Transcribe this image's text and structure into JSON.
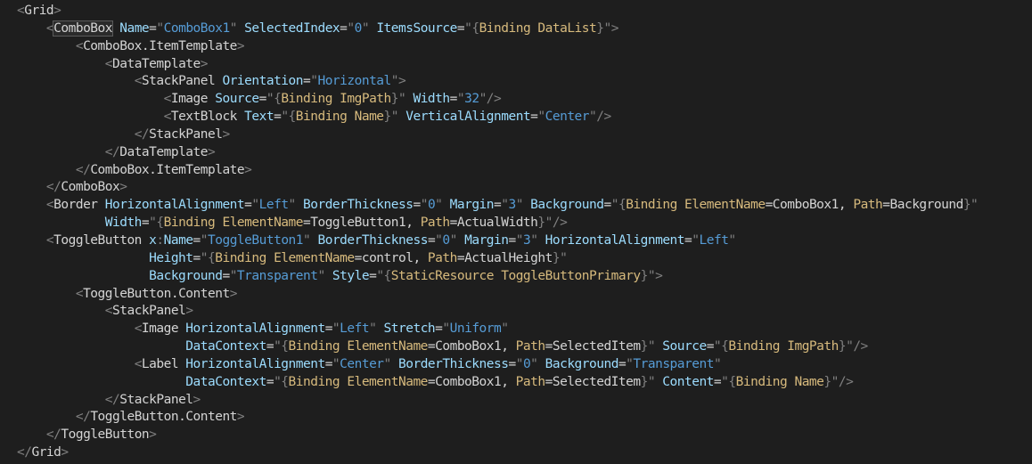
{
  "editor": {
    "background": "#1e1e1e",
    "token_colors": {
      "punctuation": "#808080",
      "tag": "#d4d4d4",
      "attribute": "#9cdcfe",
      "value": "#569cd6",
      "binding_keyword": "#d7ba7d",
      "binding_property": "#d7ba7d"
    },
    "lines": [
      {
        "indent": 0,
        "tokens": [
          [
            "p",
            "<"
          ],
          [
            "t",
            "Grid"
          ],
          [
            "p",
            ">"
          ]
        ]
      },
      {
        "indent": 4,
        "tokens": [
          [
            "p",
            "<"
          ],
          [
            "hl",
            "ComboBox"
          ],
          [
            "a",
            " Name"
          ],
          [
            "e",
            "="
          ],
          [
            "p",
            "\""
          ],
          [
            "v",
            "ComboBox1"
          ],
          [
            "p",
            "\""
          ],
          [
            "a",
            " SelectedIndex"
          ],
          [
            "e",
            "="
          ],
          [
            "p",
            "\""
          ],
          [
            "v",
            "0"
          ],
          [
            "p",
            "\""
          ],
          [
            "a",
            " ItemsSource"
          ],
          [
            "e",
            "="
          ],
          [
            "p",
            "\"{"
          ],
          [
            "bk",
            "Binding"
          ],
          [
            "bp",
            " DataList"
          ],
          [
            "p",
            "}\""
          ],
          [
            "p",
            ">"
          ]
        ]
      },
      {
        "indent": 8,
        "tokens": [
          [
            "p",
            "<"
          ],
          [
            "t",
            "ComboBox.ItemTemplate"
          ],
          [
            "p",
            ">"
          ]
        ]
      },
      {
        "indent": 12,
        "tokens": [
          [
            "p",
            "<"
          ],
          [
            "t",
            "DataTemplate"
          ],
          [
            "p",
            ">"
          ]
        ]
      },
      {
        "indent": 16,
        "tokens": [
          [
            "p",
            "<"
          ],
          [
            "t",
            "StackPanel"
          ],
          [
            "a",
            " Orientation"
          ],
          [
            "e",
            "="
          ],
          [
            "p",
            "\""
          ],
          [
            "v",
            "Horizontal"
          ],
          [
            "p",
            "\""
          ],
          [
            "p",
            ">"
          ]
        ]
      },
      {
        "indent": 20,
        "tokens": [
          [
            "p",
            "<"
          ],
          [
            "t",
            "Image"
          ],
          [
            "a",
            " Source"
          ],
          [
            "e",
            "="
          ],
          [
            "p",
            "\"{"
          ],
          [
            "bk",
            "Binding"
          ],
          [
            "bp",
            " ImgPath"
          ],
          [
            "p",
            "}\""
          ],
          [
            "a",
            " Width"
          ],
          [
            "e",
            "="
          ],
          [
            "p",
            "\""
          ],
          [
            "v",
            "32"
          ],
          [
            "p",
            "\""
          ],
          [
            "p",
            "/>"
          ]
        ]
      },
      {
        "indent": 20,
        "tokens": [
          [
            "p",
            "<"
          ],
          [
            "t",
            "TextBlock"
          ],
          [
            "a",
            " Text"
          ],
          [
            "e",
            "="
          ],
          [
            "p",
            "\"{"
          ],
          [
            "bk",
            "Binding"
          ],
          [
            "bp",
            " Name"
          ],
          [
            "p",
            "}\""
          ],
          [
            "a",
            " VerticalAlignment"
          ],
          [
            "e",
            "="
          ],
          [
            "p",
            "\""
          ],
          [
            "v",
            "Center"
          ],
          [
            "p",
            "\""
          ],
          [
            "p",
            "/>"
          ]
        ]
      },
      {
        "indent": 16,
        "tokens": [
          [
            "p",
            "</"
          ],
          [
            "t",
            "StackPanel"
          ],
          [
            "p",
            ">"
          ]
        ]
      },
      {
        "indent": 12,
        "tokens": [
          [
            "p",
            "</"
          ],
          [
            "t",
            "DataTemplate"
          ],
          [
            "p",
            ">"
          ]
        ]
      },
      {
        "indent": 8,
        "tokens": [
          [
            "p",
            "</"
          ],
          [
            "t",
            "ComboBox.ItemTemplate"
          ],
          [
            "p",
            ">"
          ]
        ]
      },
      {
        "indent": 4,
        "tokens": [
          [
            "p",
            "</"
          ],
          [
            "t",
            "ComboBox"
          ],
          [
            "p",
            ">"
          ]
        ]
      },
      {
        "indent": 4,
        "tokens": [
          [
            "p",
            "<"
          ],
          [
            "t",
            "Border"
          ],
          [
            "a",
            " HorizontalAlignment"
          ],
          [
            "e",
            "="
          ],
          [
            "p",
            "\""
          ],
          [
            "v",
            "Left"
          ],
          [
            "p",
            "\""
          ],
          [
            "a",
            " BorderThickness"
          ],
          [
            "e",
            "="
          ],
          [
            "p",
            "\""
          ],
          [
            "v",
            "0"
          ],
          [
            "p",
            "\""
          ],
          [
            "a",
            " Margin"
          ],
          [
            "e",
            "="
          ],
          [
            "p",
            "\""
          ],
          [
            "v",
            "3"
          ],
          [
            "p",
            "\""
          ],
          [
            "a",
            " Background"
          ],
          [
            "e",
            "="
          ],
          [
            "p",
            "\"{"
          ],
          [
            "bk",
            "Binding"
          ],
          [
            "bp",
            " ElementName"
          ],
          [
            "e",
            "="
          ],
          [
            "bw",
            "ComboBox1"
          ],
          [
            "e",
            ","
          ],
          [
            "bp",
            " Path"
          ],
          [
            "e",
            "="
          ],
          [
            "bw",
            "Background"
          ],
          [
            "p",
            "}\""
          ]
        ]
      },
      {
        "indent": 12,
        "tokens": [
          [
            "a",
            "Width"
          ],
          [
            "e",
            "="
          ],
          [
            "p",
            "\"{"
          ],
          [
            "bk",
            "Binding"
          ],
          [
            "bp",
            " ElementName"
          ],
          [
            "e",
            "="
          ],
          [
            "bw",
            "ToggleButton1"
          ],
          [
            "e",
            ","
          ],
          [
            "bp",
            " Path"
          ],
          [
            "e",
            "="
          ],
          [
            "bw",
            "ActualWidth"
          ],
          [
            "p",
            "}\""
          ],
          [
            "p",
            "/>"
          ]
        ]
      },
      {
        "indent": 4,
        "tokens": [
          [
            "p",
            "<"
          ],
          [
            "t",
            "ToggleButton"
          ],
          [
            "a",
            " x"
          ],
          [
            "p",
            ":"
          ],
          [
            "a",
            "Name"
          ],
          [
            "e",
            "="
          ],
          [
            "p",
            "\""
          ],
          [
            "v",
            "ToggleButton1"
          ],
          [
            "p",
            "\""
          ],
          [
            "a",
            " BorderThickness"
          ],
          [
            "e",
            "="
          ],
          [
            "p",
            "\""
          ],
          [
            "v",
            "0"
          ],
          [
            "p",
            "\""
          ],
          [
            "a",
            " Margin"
          ],
          [
            "e",
            "="
          ],
          [
            "p",
            "\""
          ],
          [
            "v",
            "3"
          ],
          [
            "p",
            "\""
          ],
          [
            "a",
            " HorizontalAlignment"
          ],
          [
            "e",
            "="
          ],
          [
            "p",
            "\""
          ],
          [
            "v",
            "Left"
          ],
          [
            "p",
            "\""
          ]
        ]
      },
      {
        "indent": 18,
        "tokens": [
          [
            "a",
            "Height"
          ],
          [
            "e",
            "="
          ],
          [
            "p",
            "\"{"
          ],
          [
            "bk",
            "Binding"
          ],
          [
            "bp",
            " ElementName"
          ],
          [
            "e",
            "="
          ],
          [
            "bw",
            "control"
          ],
          [
            "e",
            ","
          ],
          [
            "bp",
            " Path"
          ],
          [
            "e",
            "="
          ],
          [
            "bw",
            "ActualHeight"
          ],
          [
            "p",
            "}\""
          ]
        ]
      },
      {
        "indent": 18,
        "tokens": [
          [
            "a",
            "Background"
          ],
          [
            "e",
            "="
          ],
          [
            "p",
            "\""
          ],
          [
            "v",
            "Transparent"
          ],
          [
            "p",
            "\""
          ],
          [
            "a",
            " Style"
          ],
          [
            "e",
            "="
          ],
          [
            "p",
            "\"{"
          ],
          [
            "bk",
            "StaticResource"
          ],
          [
            "bp",
            " ToggleButtonPrimary"
          ],
          [
            "p",
            "}\""
          ],
          [
            "p",
            ">"
          ]
        ]
      },
      {
        "indent": 8,
        "tokens": [
          [
            "p",
            "<"
          ],
          [
            "t",
            "ToggleButton.Content"
          ],
          [
            "p",
            ">"
          ]
        ]
      },
      {
        "indent": 12,
        "tokens": [
          [
            "p",
            "<"
          ],
          [
            "t",
            "StackPanel"
          ],
          [
            "p",
            ">"
          ]
        ]
      },
      {
        "indent": 16,
        "tokens": [
          [
            "p",
            "<"
          ],
          [
            "t",
            "Image"
          ],
          [
            "a",
            " HorizontalAlignment"
          ],
          [
            "e",
            "="
          ],
          [
            "p",
            "\""
          ],
          [
            "v",
            "Left"
          ],
          [
            "p",
            "\""
          ],
          [
            "a",
            " Stretch"
          ],
          [
            "e",
            "="
          ],
          [
            "p",
            "\""
          ],
          [
            "v",
            "Uniform"
          ],
          [
            "p",
            "\""
          ]
        ]
      },
      {
        "indent": 23,
        "tokens": [
          [
            "a",
            "DataContext"
          ],
          [
            "e",
            "="
          ],
          [
            "p",
            "\"{"
          ],
          [
            "bk",
            "Binding"
          ],
          [
            "bp",
            " ElementName"
          ],
          [
            "e",
            "="
          ],
          [
            "bw",
            "ComboBox1"
          ],
          [
            "e",
            ","
          ],
          [
            "bp",
            " Path"
          ],
          [
            "e",
            "="
          ],
          [
            "bw",
            "SelectedItem"
          ],
          [
            "p",
            "}\""
          ],
          [
            "a",
            " Source"
          ],
          [
            "e",
            "="
          ],
          [
            "p",
            "\"{"
          ],
          [
            "bk",
            "Binding"
          ],
          [
            "bp",
            " ImgPath"
          ],
          [
            "p",
            "}\""
          ],
          [
            "p",
            "/>"
          ]
        ]
      },
      {
        "indent": 16,
        "tokens": [
          [
            "p",
            "<"
          ],
          [
            "t",
            "Label"
          ],
          [
            "a",
            " HorizontalAlignment"
          ],
          [
            "e",
            "="
          ],
          [
            "p",
            "\""
          ],
          [
            "v",
            "Center"
          ],
          [
            "p",
            "\""
          ],
          [
            "a",
            " BorderThickness"
          ],
          [
            "e",
            "="
          ],
          [
            "p",
            "\""
          ],
          [
            "v",
            "0"
          ],
          [
            "p",
            "\""
          ],
          [
            "a",
            " Background"
          ],
          [
            "e",
            "="
          ],
          [
            "p",
            "\""
          ],
          [
            "v",
            "Transparent"
          ],
          [
            "p",
            "\""
          ]
        ]
      },
      {
        "indent": 23,
        "tokens": [
          [
            "a",
            "DataContext"
          ],
          [
            "e",
            "="
          ],
          [
            "p",
            "\"{"
          ],
          [
            "bk",
            "Binding"
          ],
          [
            "bp",
            " ElementName"
          ],
          [
            "e",
            "="
          ],
          [
            "bw",
            "ComboBox1"
          ],
          [
            "e",
            ","
          ],
          [
            "bp",
            " Path"
          ],
          [
            "e",
            "="
          ],
          [
            "bw",
            "SelectedItem"
          ],
          [
            "p",
            "}\""
          ],
          [
            "a",
            " Content"
          ],
          [
            "e",
            "="
          ],
          [
            "p",
            "\"{"
          ],
          [
            "bk",
            "Binding"
          ],
          [
            "bp",
            " Name"
          ],
          [
            "p",
            "}\""
          ],
          [
            "p",
            "/>"
          ]
        ]
      },
      {
        "indent": 12,
        "tokens": [
          [
            "p",
            "</"
          ],
          [
            "t",
            "StackPanel"
          ],
          [
            "p",
            ">"
          ]
        ]
      },
      {
        "indent": 8,
        "tokens": [
          [
            "p",
            "</"
          ],
          [
            "t",
            "ToggleButton.Content"
          ],
          [
            "p",
            ">"
          ]
        ]
      },
      {
        "indent": 4,
        "tokens": [
          [
            "p",
            "</"
          ],
          [
            "t",
            "ToggleButton"
          ],
          [
            "p",
            ">"
          ]
        ]
      },
      {
        "indent": 0,
        "tokens": [
          [
            "p",
            "</"
          ],
          [
            "t",
            "Grid"
          ],
          [
            "p",
            ">"
          ]
        ]
      }
    ]
  }
}
